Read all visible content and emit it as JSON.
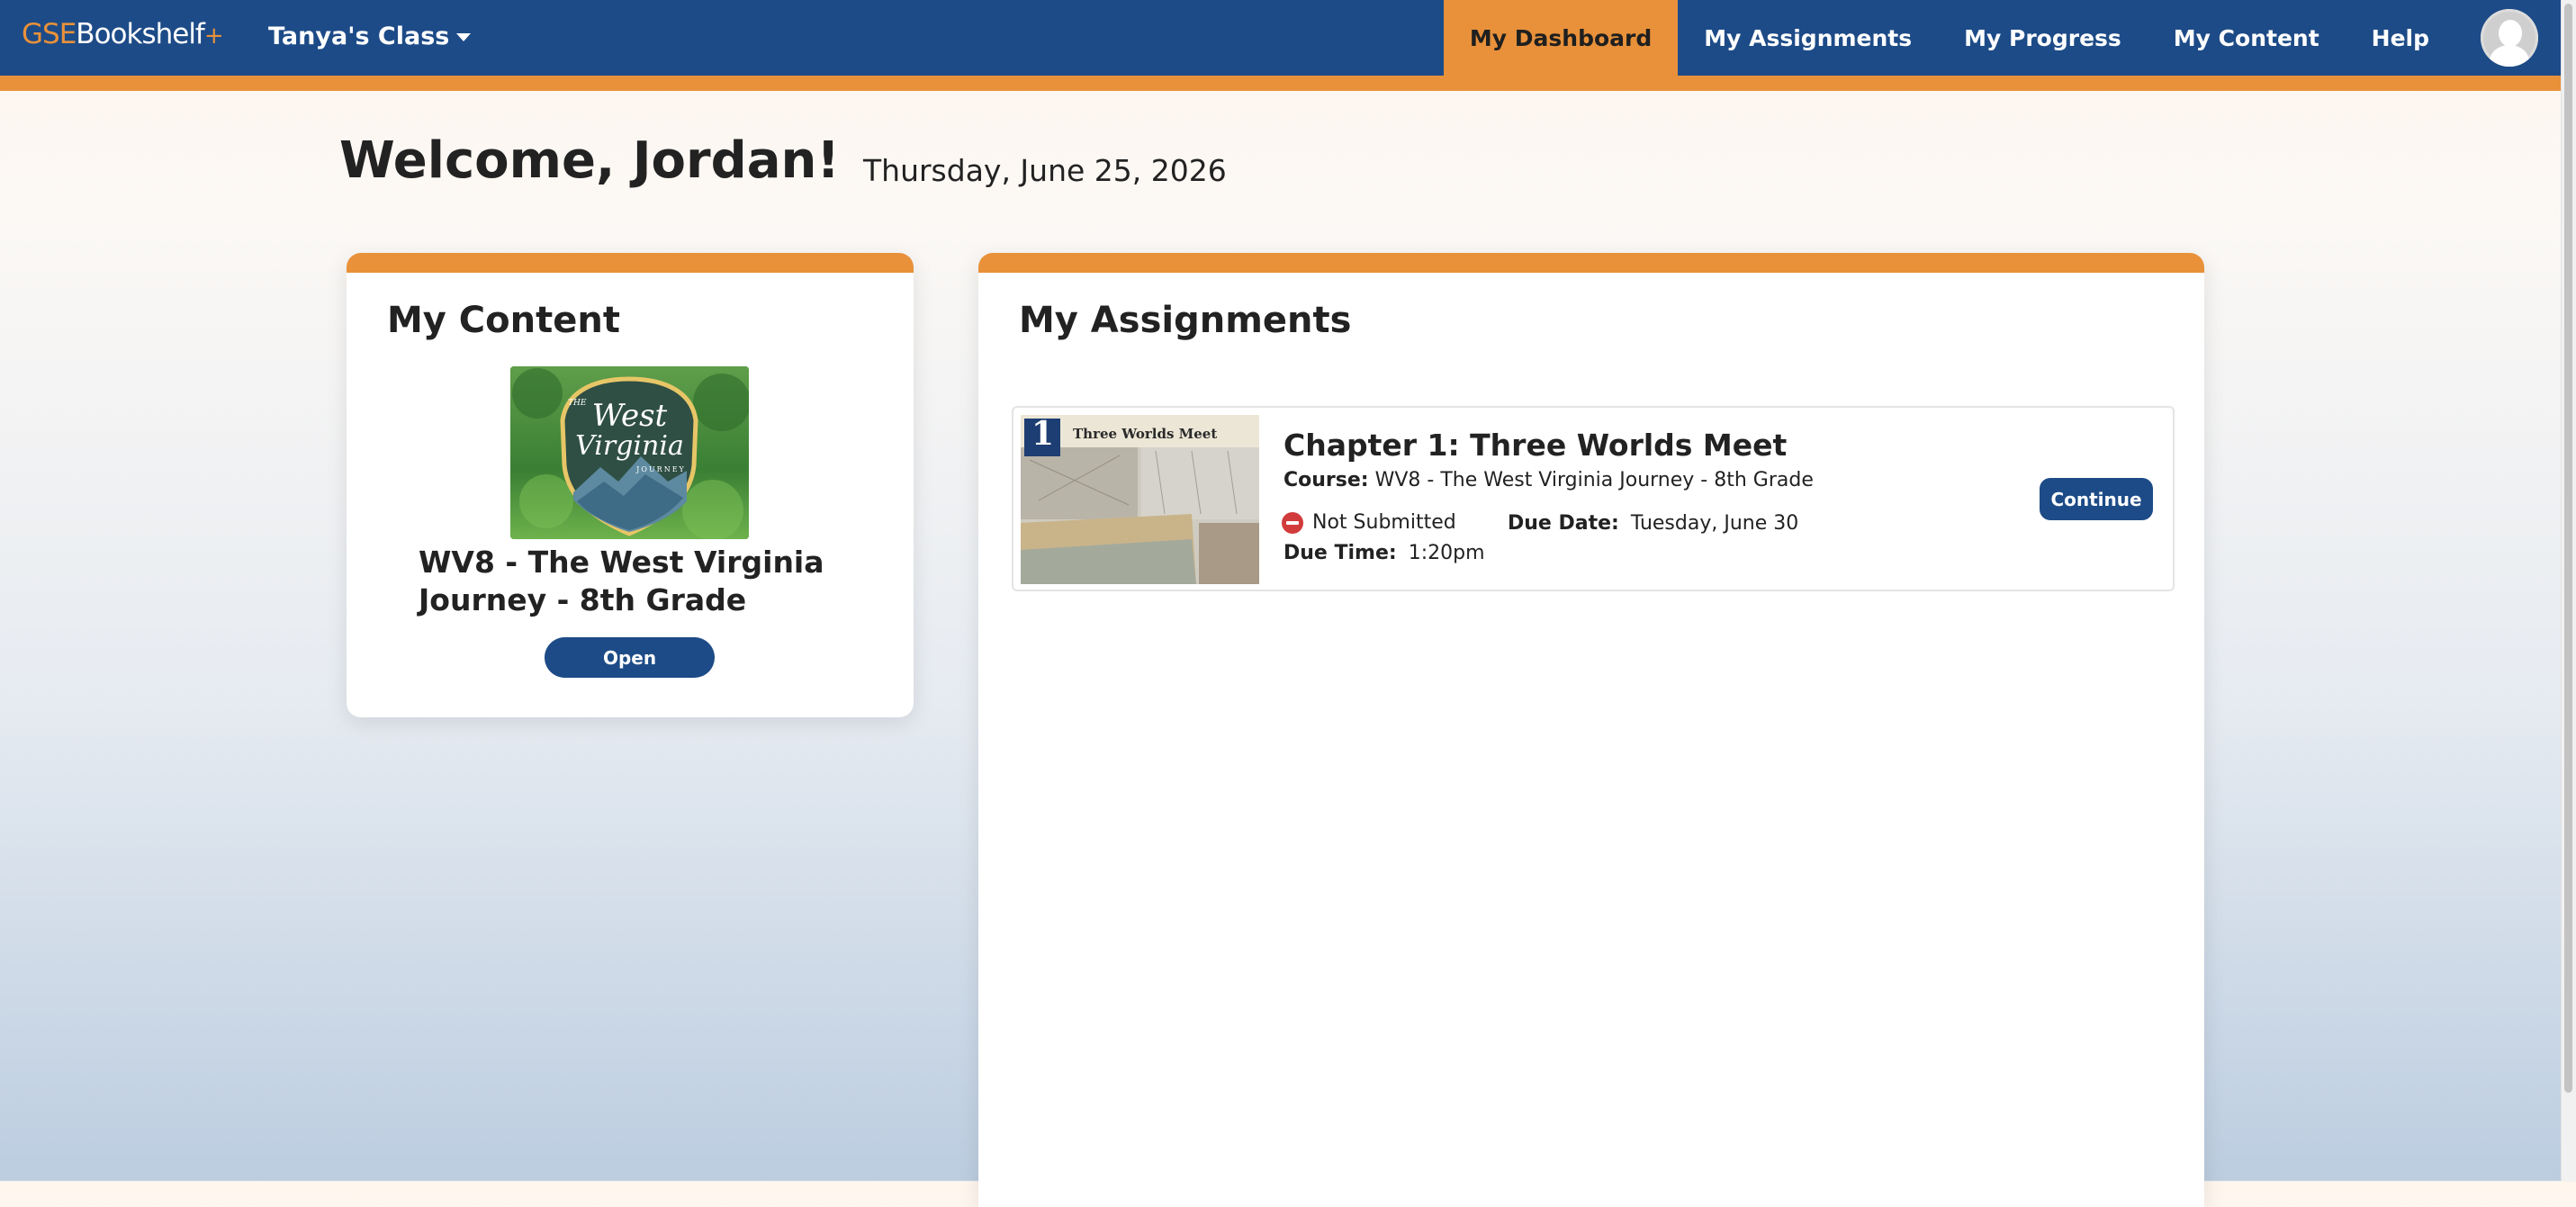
{
  "header": {
    "logo": {
      "gse": "GSE",
      "bookshelf": "Bookshelf",
      "plus": "+"
    },
    "class_selector": "Tanya's Class",
    "nav": [
      {
        "label": "My Dashboard",
        "active": true
      },
      {
        "label": "My Assignments",
        "active": false
      },
      {
        "label": "My Progress",
        "active": false
      },
      {
        "label": "My Content",
        "active": false
      },
      {
        "label": "Help",
        "active": false
      }
    ]
  },
  "welcome": {
    "greeting": "Welcome, Jordan!",
    "date": "Thursday, June 25, 2026"
  },
  "my_content": {
    "heading": "My Content",
    "book": {
      "cover_text_small": "THE",
      "cover_title_line1": "West",
      "cover_title_line2": "Virginia",
      "cover_subtitle": "JOURNEY",
      "title": "WV8 - The West Virginia Journey - 8th Grade",
      "open_label": "Open"
    }
  },
  "my_assignments": {
    "heading": "My Assignments",
    "items": [
      {
        "thumb_number": "1",
        "thumb_caption": "Three Worlds Meet",
        "title": "Chapter 1: Three Worlds Meet",
        "course_label": "Course:",
        "course": "WV8 - The West Virginia Journey - 8th Grade",
        "status": "Not Submitted",
        "due_date_label": "Due Date:",
        "due_date": "Tuesday, June 30",
        "due_time_label": "Due Time:",
        "due_time": "1:20pm",
        "continue_label": "Continue"
      }
    ]
  },
  "colors": {
    "brand_blue": "#1d4b87",
    "accent_orange": "#e8913a",
    "status_red": "#d23b3b"
  }
}
